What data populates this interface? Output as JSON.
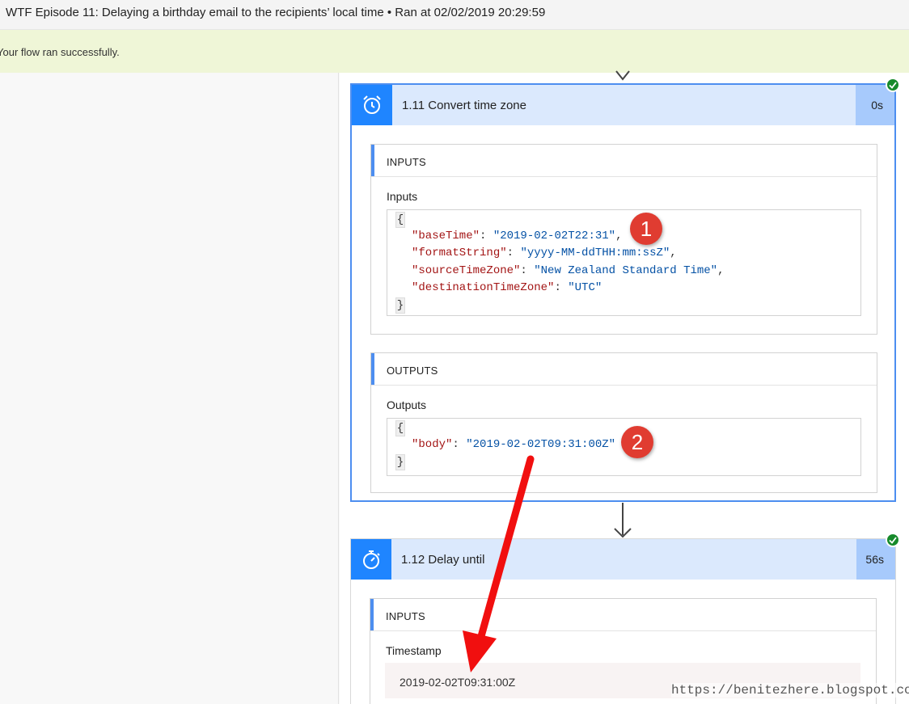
{
  "header": {
    "title": "WTF Episode 11: Delaying a birthday email to the recipients’ local time • Ran at 02/02/2019 20:29:59"
  },
  "banner": {
    "message": "Your flow ran successfully."
  },
  "step1": {
    "title": "1.11 Convert time zone",
    "duration": "0s",
    "icon": "alarm-clock-icon",
    "inputs_title": "INPUTS",
    "inputs_label": "Inputs",
    "inputs_code": {
      "open": "{",
      "close": "}",
      "lines": [
        {
          "key": "\"baseTime\"",
          "value": "\"2019-02-02T22:31\"",
          "tail": ","
        },
        {
          "key": "\"formatString\"",
          "value": "\"yyyy-MM-ddTHH:mm:ssZ\"",
          "tail": ","
        },
        {
          "key": "\"sourceTimeZone\"",
          "value": "\"New Zealand Standard Time\"",
          "tail": ","
        },
        {
          "key": "\"destinationTimeZone\"",
          "value": "\"UTC\"",
          "tail": ""
        }
      ]
    },
    "outputs_title": "OUTPUTS",
    "outputs_label": "Outputs",
    "outputs_code": {
      "open": "{",
      "close": "}",
      "lines": [
        {
          "key": "\"body\"",
          "value": "\"2019-02-02T09:31:00Z\"",
          "tail": ""
        }
      ]
    }
  },
  "step2": {
    "title": "1.12 Delay until",
    "duration": "56s",
    "icon": "stopwatch-icon",
    "inputs_title": "INPUTS",
    "timestamp_label": "Timestamp",
    "timestamp_value": "2019-02-02T09:31:00Z"
  },
  "annotations": {
    "badge1": "1",
    "badge2": "2"
  },
  "watermark": "https://benitezhere.blogspot.com",
  "colors": {
    "accent": "#1f85ff",
    "success": "#178a2b",
    "banner": "#eff6d7",
    "annotation": "#e03c31"
  }
}
